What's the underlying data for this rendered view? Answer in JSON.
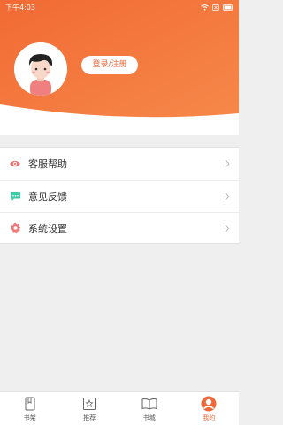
{
  "status_bar": {
    "time": "下午4:03",
    "icons": [
      "wifi-icon",
      "sim-icon",
      "battery-icon"
    ]
  },
  "profile": {
    "avatar_icon": "user-avatar-icon",
    "login_label": "登录/注册"
  },
  "menu": {
    "items": [
      {
        "label": "客服帮助",
        "icon": "help-eye-icon",
        "icon_color": "#f26d6d"
      },
      {
        "label": "意见反馈",
        "icon": "feedback-chat-icon",
        "icon_color": "#3ecba7"
      },
      {
        "label": "系统设置",
        "icon": "settings-gear-icon",
        "icon_color": "#f07a7a"
      }
    ]
  },
  "tabbar": {
    "tabs": [
      {
        "label": "书架",
        "icon": "bookshelf-icon",
        "active": false
      },
      {
        "label": "推荐",
        "icon": "recommend-icon",
        "active": false
      },
      {
        "label": "书城",
        "icon": "bookstore-icon",
        "active": false
      },
      {
        "label": "我的",
        "icon": "profile-icon",
        "active": true
      }
    ]
  },
  "colors": {
    "accent": "#f0673a",
    "header_gradient_start": "#f26a34",
    "header_gradient_end": "#f6884a",
    "background": "#efefef"
  }
}
